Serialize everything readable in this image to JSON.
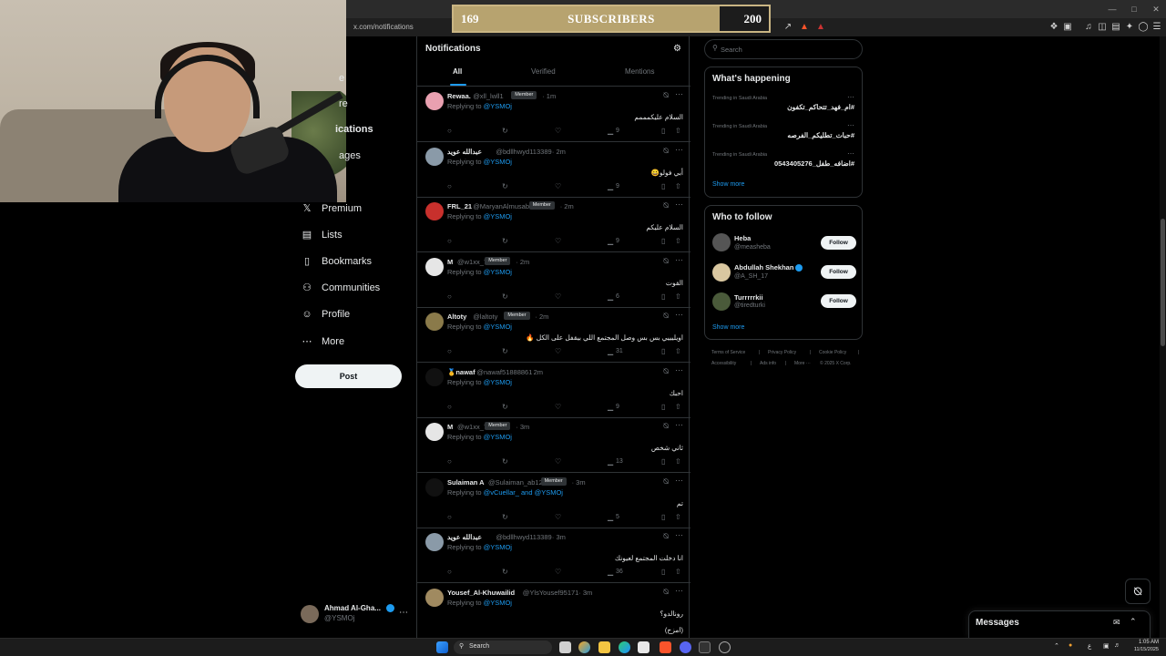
{
  "browser": {
    "url": "x.com/notifications"
  },
  "overlay": {
    "current": "169",
    "label": "SUBSCRIBERS",
    "goal": "200",
    "progress_fraction": 0.845
  },
  "nav": {
    "items": [
      {
        "label": "e",
        "icon": "home-icon"
      },
      {
        "label": "re",
        "icon": "explore-icon"
      },
      {
        "label": "ications",
        "icon": "bell-icon"
      },
      {
        "label": "ages",
        "icon": "mail-icon"
      },
      {
        "label": "Premium",
        "icon": "x-logo-icon"
      },
      {
        "label": "Lists",
        "icon": "list-icon"
      },
      {
        "label": "Bookmarks",
        "icon": "bookmark-icon"
      },
      {
        "label": "Communities",
        "icon": "communities-icon"
      },
      {
        "label": "Profile",
        "icon": "person-icon"
      },
      {
        "label": "More",
        "icon": "more-circle-icon"
      }
    ],
    "post_label": "Post",
    "account": {
      "name": "Ahmad Al-Gha...",
      "handle": "@YSMOj"
    }
  },
  "notifications": {
    "title": "Notifications",
    "tabs": [
      "All",
      "Verified",
      "Mentions"
    ],
    "active_tab": "All",
    "items": [
      {
        "name": "Rewaa.",
        "handle": "@xll_lwll1",
        "badge": "Member",
        "time": "· 1m",
        "replying": "Replying to ",
        "mention": "@YSMOj",
        "text": "السلام عليكمممم",
        "likes": "9",
        "avatar_color": "#e9a0b0"
      },
      {
        "name": "عبدالله عويد",
        "handle": "@bdllhwyd113389",
        "badge": "",
        "time": "· 2m",
        "replying": "Replying to ",
        "mention": "@YSMOj",
        "text": "أبي فولو😀",
        "likes": "9",
        "avatar_color": "#8a9aa8"
      },
      {
        "name": "FRL_21",
        "handle": "@MaryanAlmusabi",
        "badge": "Member",
        "time": "· 2m",
        "replying": "Replying to ",
        "mention": "@YSMOj",
        "text": "السلام عليكم",
        "likes": "9",
        "avatar_color": "#c8302c"
      },
      {
        "name": "M",
        "handle": "@w1xx_7",
        "badge": "Member",
        "time": "· 2m",
        "replying": "Replying to ",
        "mention": "@YSMOj",
        "text": "القوت",
        "likes": "6",
        "avatar_color": "#e6e6e6"
      },
      {
        "name": "Altoty",
        "handle": "@laltoty",
        "badge": "Member",
        "time": "· 2m",
        "replying": "Replying to ",
        "mention": "@YSMOj",
        "text": "اويليييي بس بس وصل المجتمع اللي بيقفل على الكل 🔥",
        "likes": "31",
        "avatar_color": "#8a7a4a"
      },
      {
        "name": "🥇nawaf",
        "handle": "@nawaf51888861",
        "badge": "",
        "time": "· 2m",
        "replying": "Replying to ",
        "mention": "@YSMOj",
        "text": "احبك",
        "likes": "9",
        "avatar_color": "#111111"
      },
      {
        "name": "M",
        "handle": "@w1xx_7",
        "badge": "Member",
        "time": "· 3m",
        "replying": "Replying to ",
        "mention": "@YSMOj",
        "text": "ثاني شخص",
        "likes": "13",
        "avatar_color": "#e6e6e6"
      },
      {
        "name": "Sulaiman A",
        "handle": "@Sulaiman_ab12",
        "badge": "Member",
        "time": "· 3m",
        "replying": "Replying to ",
        "mention": "@vCuellar_ and @YSMOj",
        "text": "تم",
        "likes": "5",
        "avatar_color": "#111111"
      },
      {
        "name": "عبدالله عويد",
        "handle": "@bdllhwyd113389",
        "badge": "",
        "time": "· 3m",
        "replying": "Replying to ",
        "mention": "@YSMOj",
        "text": "انا دخلت المجتمع لعيونك",
        "likes": "36",
        "avatar_color": "#8a9aa8"
      },
      {
        "name": "Yousef_Al-Khuwailid",
        "handle": "@YlsYousef95171",
        "badge": "",
        "time": "· 3m",
        "replying": "Replying to ",
        "mention": "@YSMOj",
        "text": "رونالدو؟",
        "text2": "(امزح)",
        "likes": "",
        "avatar_color": "#a08a60"
      }
    ]
  },
  "right": {
    "search_placeholder": "Search",
    "happening": {
      "title": "What's happening",
      "trends": [
        {
          "location": "Trending in Saudi Arabia",
          "name": "#ام_فهد_تتحاكم_تكفون"
        },
        {
          "location": "Trending in Saudi Arabia",
          "name": "#حبات_تطليكم_الفرصه"
        },
        {
          "location": "Trending in Saudi Arabia",
          "name": "#اضافه_طفل_0543405276"
        }
      ],
      "show_more": "Show more"
    },
    "who_to_follow": {
      "title": "Who to follow",
      "accounts": [
        {
          "name": "Heba",
          "handle": "@measheba",
          "verified": false,
          "avatar_color": "#555555"
        },
        {
          "name": "Abdullah Shekhan",
          "handle": "@A_SH_17",
          "verified": true,
          "avatar_color": "#d9c7a0"
        },
        {
          "name": "Turrrrrkii",
          "handle": "@tiredturki",
          "verified": false,
          "avatar_color": "#4a5a3a"
        }
      ],
      "follow_label": "Follow",
      "show_more": "Show more"
    },
    "footer": {
      "line1": [
        "Terms of Service",
        "|",
        "Privacy Policy",
        "|",
        "Cookie Policy",
        "|"
      ],
      "line2": [
        "Accessibility",
        "|",
        "Ads info",
        "|",
        "More ···",
        "© 2025 X Corp."
      ]
    }
  },
  "messages": {
    "title": "Messages"
  },
  "taskbar": {
    "search_label": "Search",
    "time": "1:05 AM",
    "date": "11/15/2025",
    "lang": "ع"
  },
  "colors": {
    "accent": "#1d9bf0",
    "border": "#2f3336",
    "muted": "#71767b",
    "overlay_gold": "#b7a36f"
  }
}
